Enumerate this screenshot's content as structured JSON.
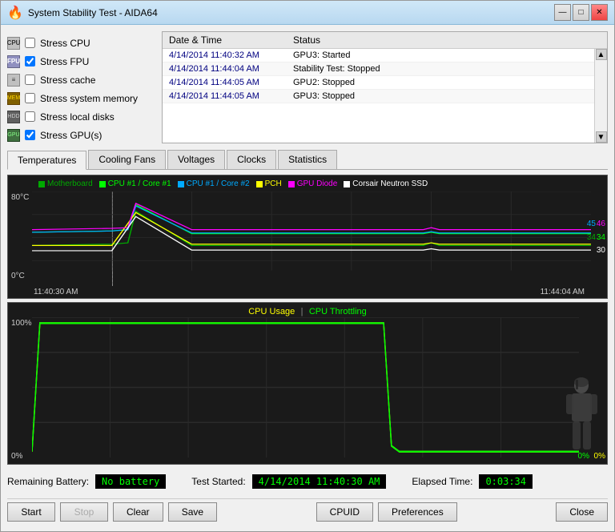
{
  "window": {
    "title": "System Stability Test - AIDA64",
    "icon": "🔥"
  },
  "title_controls": {
    "minimize": "—",
    "maximize": "□",
    "close": "✕"
  },
  "checkboxes": [
    {
      "id": "cb-cpu",
      "label": "Stress CPU",
      "checked": false,
      "icon": "CPU"
    },
    {
      "id": "cb-fpu",
      "label": "Stress FPU",
      "checked": true,
      "icon": "FPU"
    },
    {
      "id": "cb-cache",
      "label": "Stress cache",
      "checked": false,
      "icon": "≡"
    },
    {
      "id": "cb-mem",
      "label": "Stress system memory",
      "checked": false,
      "icon": "MEM"
    },
    {
      "id": "cb-disk",
      "label": "Stress local disks",
      "checked": false,
      "icon": "HDD"
    },
    {
      "id": "cb-gpu",
      "label": "Stress GPU(s)",
      "checked": true,
      "icon": "GPU"
    }
  ],
  "log": {
    "headers": [
      "Date & Time",
      "Status"
    ],
    "rows": [
      {
        "time": "4/14/2014 11:40:32 AM",
        "status": "GPU3: Started"
      },
      {
        "time": "4/14/2014 11:44:04 AM",
        "status": "Stability Test: Stopped"
      },
      {
        "time": "4/14/2014 11:44:05 AM",
        "status": "GPU2: Stopped"
      },
      {
        "time": "4/14/2014 11:44:05 AM",
        "status": "GPU3: Stopped"
      }
    ]
  },
  "tabs": [
    {
      "id": "temperatures",
      "label": "Temperatures",
      "active": true
    },
    {
      "id": "cooling-fans",
      "label": "Cooling Fans",
      "active": false
    },
    {
      "id": "voltages",
      "label": "Voltages",
      "active": false
    },
    {
      "id": "clocks",
      "label": "Clocks",
      "active": false
    },
    {
      "id": "statistics",
      "label": "Statistics",
      "active": false
    }
  ],
  "temp_chart": {
    "legend": [
      {
        "label": "Motherboard",
        "color": "#00aa00"
      },
      {
        "label": "CPU #1 / Core #1",
        "color": "#00ff00"
      },
      {
        "label": "CPU #1 / Core #2",
        "color": "#00aaff"
      },
      {
        "label": "PCH",
        "color": "#ffff00"
      },
      {
        "label": "GPU Diode",
        "color": "#ff00ff"
      },
      {
        "label": "Corsair Neutron SSD",
        "color": "#ffffff"
      }
    ],
    "y_max": "80°C",
    "y_min": "0°C",
    "x_start": "11:40:30 AM",
    "x_end": "11:44:04 AM",
    "values": {
      "right_45": "45",
      "right_46": "46",
      "right_34": "34",
      "right_34b": "34",
      "right_30": "30"
    }
  },
  "cpu_chart": {
    "title_usage": "CPU Usage",
    "separator": "|",
    "title_throttling": "CPU Throttling",
    "y_max": "100%",
    "y_min": "0%",
    "val_right_0a": "0%",
    "val_right_0b": "0%"
  },
  "status_bar": {
    "battery_label": "Remaining Battery:",
    "battery_value": "No battery",
    "test_started_label": "Test Started:",
    "test_started_value": "4/14/2014 11:40:30 AM",
    "elapsed_label": "Elapsed Time:",
    "elapsed_value": "0:03:34"
  },
  "buttons": {
    "start": "Start",
    "stop": "Stop",
    "clear": "Clear",
    "save": "Save",
    "cpuid": "CPUID",
    "preferences": "Preferences",
    "close": "Close"
  }
}
